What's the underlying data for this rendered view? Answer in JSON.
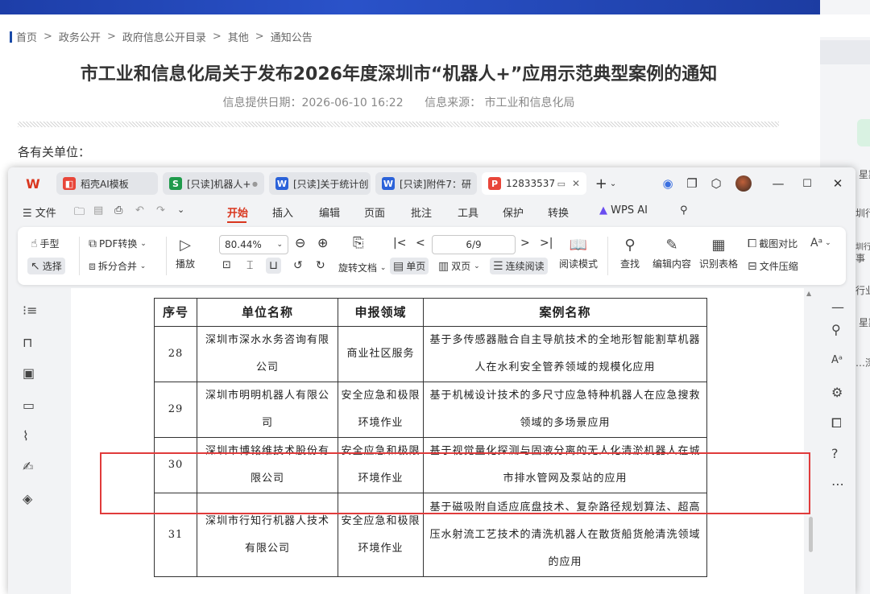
{
  "website": {
    "breadcrumb": [
      "首页",
      "政务公开",
      "政府信息公开目录",
      "其他",
      "通知公告"
    ],
    "title": "市工业和信息化局关于发布2026年度深圳市“机器人+”应用示范典型案例的通知",
    "meta": {
      "date": "信息提供日期：2026-06-10 16:22",
      "source": "信息来源： 市工业和信息化局"
    },
    "greeting": "各有关单位："
  },
  "right_app": {
    "texts": [
      "星期",
      "圳行",
      "圳行业",
      "事",
      "行业",
      "星期",
      "…深"
    ]
  },
  "wps": {
    "tabs": [
      {
        "label": "稻壳AI模板",
        "icon": "docer-icon",
        "color": "#e8463a"
      },
      {
        "label": "[只读]机器人+",
        "icon": "sheet-icon",
        "color": "#1f9a4b"
      },
      {
        "label": "[只读]关于统计创",
        "icon": "word-icon",
        "color": "#2b62d9"
      },
      {
        "label": "[只读]附件7：研",
        "icon": "word-icon",
        "color": "#2b62d9"
      },
      {
        "label": "12833537",
        "icon": "pdf-icon",
        "color": "#e8463a"
      }
    ],
    "menu": {
      "file": "文件",
      "items": [
        "开始",
        "插入",
        "编辑",
        "页面",
        "批注",
        "工具",
        "保护",
        "转换"
      ],
      "ai": "WPS AI"
    },
    "toolbar": {
      "hand": "手型",
      "select": "选择",
      "pdf_convert": "PDF转换",
      "split_merge": "拆分合并",
      "play": "播放",
      "zoom": "80.44%",
      "rotate": "旋转文档",
      "single": "单页",
      "double": "双页",
      "continuous": "连续阅读",
      "read_mode": "阅读模式",
      "page": "6/9",
      "find": "查找",
      "edit": "编辑内容",
      "recognize": "识别表格",
      "compare": "截图对比",
      "compress": "文件压缩"
    },
    "table": {
      "headers": [
        "序号",
        "单位名称",
        "申报领域",
        "案例名称"
      ],
      "rows": [
        {
          "no": "28",
          "unit": [
            "深圳市深水水务咨询有限",
            "公司"
          ],
          "domain": [
            "商业社区服务"
          ],
          "case": [
            "基于多传感器融合自主导航技术的全地形智能割草机器",
            "人在水利安全管养领域的规模化应用"
          ]
        },
        {
          "no": "29",
          "unit": [
            "深圳市明明机器人有限公",
            "司"
          ],
          "domain": [
            "安全应急和极限",
            "环境作业"
          ],
          "case": [
            "基于机械设计技术的多尺寸应急特种机器人在应急搜救",
            "领域的多场景应用"
          ]
        },
        {
          "no": "30",
          "unit": [
            "深圳市博铭维技术股份有",
            "限公司"
          ],
          "domain": [
            "安全应急和极限",
            "环境作业"
          ],
          "case": [
            "基于视觉量化探测与固液分离的无人化清淤机器人在城",
            "市排水管网及泵站的应用"
          ]
        },
        {
          "no": "31",
          "unit": [
            "深圳市行知行机器人技术",
            "有限公司"
          ],
          "domain": [
            "安全应急和极限",
            "环境作业"
          ],
          "case": [
            "基于磁吸附自适应底盘技术、复杂路径规划算法、超高",
            "压水射流工艺技术的清洗机器人在散货船货舱清洗领域",
            "的应用"
          ]
        }
      ]
    },
    "colors": {
      "accent": "#d9361e",
      "highlight": "#e03b3b"
    }
  }
}
